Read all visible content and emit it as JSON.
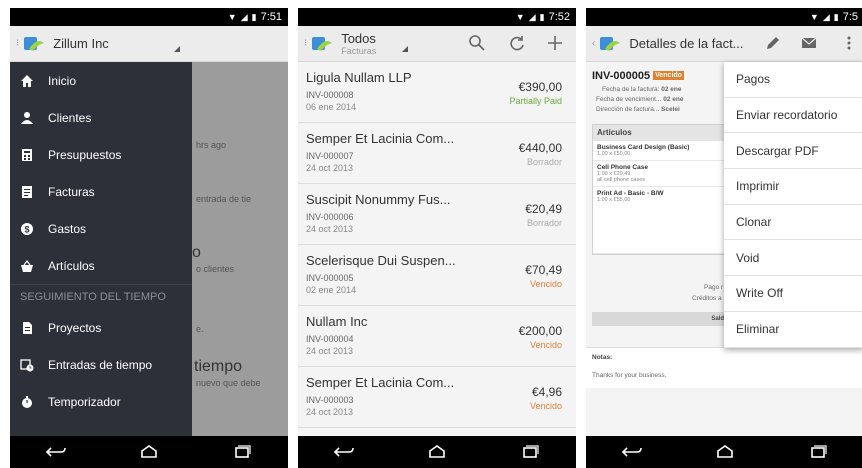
{
  "phone1": {
    "time": "7:51",
    "account": "Zillum Inc",
    "menu": [
      {
        "label": "Inicio",
        "icon": "home-icon"
      },
      {
        "label": "Clientes",
        "icon": "person-icon"
      },
      {
        "label": "Presupuestos",
        "icon": "calculator-icon"
      },
      {
        "label": "Facturas",
        "icon": "invoice-icon"
      },
      {
        "label": "Gastos",
        "icon": "dollar-icon"
      },
      {
        "label": "Artículos",
        "icon": "basket-icon"
      }
    ],
    "section": "SEGUIMIENTO DEL TIEMPO",
    "time_menu": [
      {
        "label": "Proyectos",
        "icon": "document-icon"
      },
      {
        "label": "Entradas de tiempo",
        "icon": "calendar-clock-icon"
      },
      {
        "label": "Temporizador",
        "icon": "stopwatch-icon"
      }
    ],
    "background": {
      "t1": "hrs ago",
      "t2": "entrada de tie",
      "t3": "o",
      "t4": "o clientes",
      "t5": "tiempo",
      "t6": "nuevo que debe",
      "t7": "e."
    }
  },
  "phone2": {
    "time": "7:52",
    "title": "Todos",
    "subtitle": "Facturas",
    "invoices": [
      {
        "client": "Ligula Nullam LLP",
        "number": "INV-000008",
        "date": "06 ene 2014",
        "amount": "€390,00",
        "status": "Partially Paid",
        "status_color": "#6aaa3a"
      },
      {
        "client": "Semper Et Lacinia Com...",
        "number": "INV-000007",
        "date": "24 oct 2013",
        "amount": "€440,00",
        "status": "Borrador",
        "status_color": "#aaaaaa"
      },
      {
        "client": "Suscipit Nonummy Fus...",
        "number": "INV-000006",
        "date": "24 oct 2013",
        "amount": "€20,49",
        "status": "Borrador",
        "status_color": "#aaaaaa"
      },
      {
        "client": "Scelerisque Dui Suspen...",
        "number": "INV-000005",
        "date": "02 ene 2014",
        "amount": "€70,49",
        "status": "Vencido",
        "status_color": "#e0803a"
      },
      {
        "client": "Nullam Inc",
        "number": "INV-000004",
        "date": "24 oct 2013",
        "amount": "€200,00",
        "status": "Vencido",
        "status_color": "#e0803a"
      },
      {
        "client": "Semper Et Lacinia Com...",
        "number": "INV-000003",
        "date": "24 oct 2013",
        "amount": "€4,96",
        "status": "Vencido",
        "status_color": "#e0803a"
      }
    ]
  },
  "phone3": {
    "time": "7:5",
    "title": "Detalles de la fact...",
    "invoice_number": "INV-000005",
    "badge": "Vencido",
    "meta": [
      {
        "label": "Fecha de la factura:",
        "value": "02 ene"
      },
      {
        "label": "Fecha de vencimient...",
        "value": "02 ene"
      },
      {
        "label": "Dirección de factura...",
        "value": "Scelei"
      }
    ],
    "items_header": "Artículos",
    "items": [
      {
        "name": "Business Card Design (Basic)",
        "sub1": "1.00 x €50,00",
        "sub2": ""
      },
      {
        "name": "Cell Phone Case",
        "sub1": "1.00 x €20,49",
        "sub2": "all cell phone cases"
      },
      {
        "name": "Print Ad - Basic - B/W",
        "sub1": "1.00 x €55,00",
        "sub2": ""
      }
    ],
    "totals": {
      "pago": "Pago r",
      "creditos": "Créditos a",
      "saldo": "Saldo a"
    },
    "notes_label": "Notas:",
    "notes_text": "Thanks for your business.",
    "menu": [
      "Pagos",
      "Enviar recordatorio",
      "Descargar PDF",
      "Imprimir",
      "Clonar",
      "Void",
      "Write Off",
      "Eliminar"
    ]
  }
}
